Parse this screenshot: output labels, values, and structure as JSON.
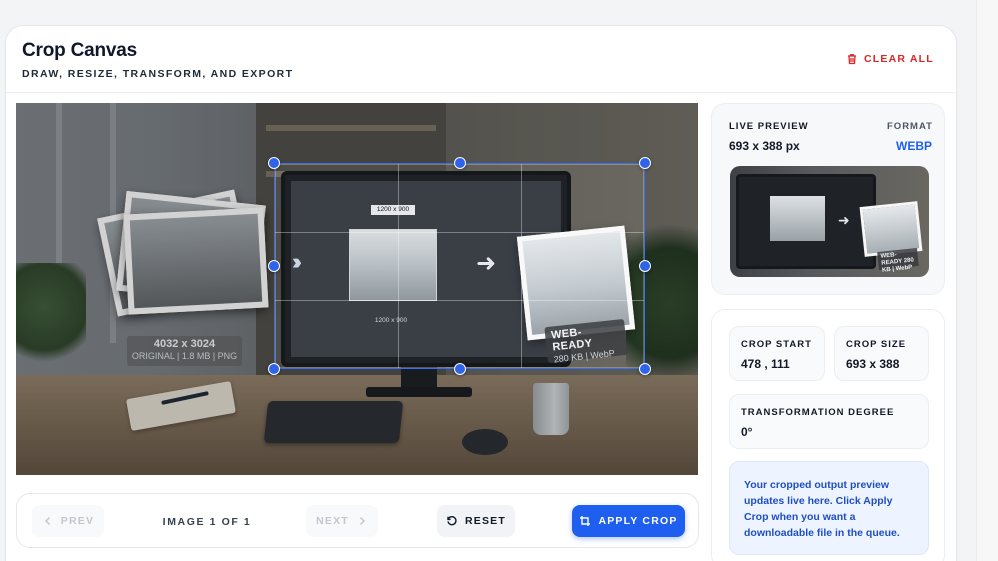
{
  "header": {
    "title": "Crop Canvas",
    "subtitle": "DRAW, RESIZE, TRANSFORM, AND EXPORT",
    "clear_all_label": "CLEAR ALL"
  },
  "canvas": {
    "original_label": {
      "dimensions": "4032 x 3024",
      "meta": "ORIGINAL | 1.8 MB | PNG"
    },
    "screen_dim_top": "1200 x 900",
    "screen_dim_bottom": "1200 x 900",
    "webready_badge": {
      "title": "WEB-READY",
      "meta": "280 KB | WebP"
    }
  },
  "pager": {
    "prev_label": "PREV",
    "next_label": "NEXT",
    "counter": "IMAGE 1 OF 1",
    "reset_label": "RESET",
    "apply_label": "APPLY CROP"
  },
  "preview": {
    "live_label": "LIVE PREVIEW",
    "live_value": "693 x 388 px",
    "format_label": "FORMAT",
    "format_value": "WEBP",
    "thumb_badge": "WEB-READY 280 KB | WebP"
  },
  "stats": {
    "crop_start_label": "CROP START",
    "crop_start_value": "478 , 111",
    "crop_size_label": "CROP SIZE",
    "crop_size_value": "693 x 388",
    "transform_label": "TRANSFORMATION DEGREE",
    "transform_value": "0°"
  },
  "note": "Your cropped output preview updates live here. Click Apply Crop when you want a downloadable file in the queue.",
  "colors": {
    "accent": "#1f5ff0",
    "danger": "#dc2626",
    "handle": "#2f63e8"
  },
  "icons": {
    "clear_all": "trash-icon",
    "prev": "chevron-left-icon",
    "next": "chevron-right-icon",
    "reset": "rotate-ccw-icon",
    "apply": "crop-icon"
  }
}
